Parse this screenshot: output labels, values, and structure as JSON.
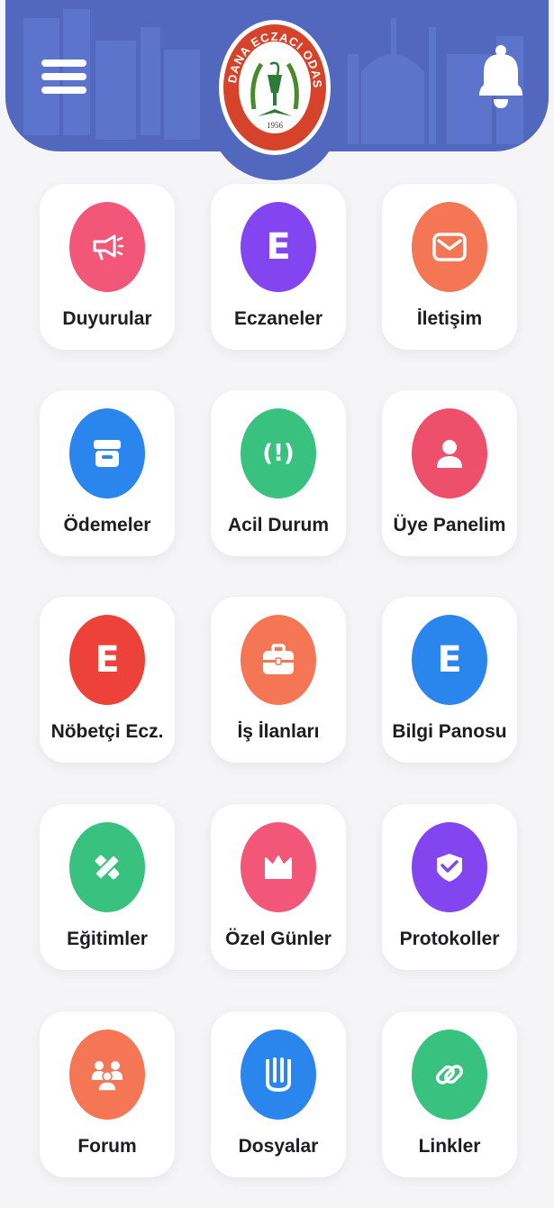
{
  "header": {
    "logo_text": "ADANA ECZACI ODASI",
    "logo_year": "1956",
    "menu_icon": "hamburger-menu-icon",
    "bell_icon": "bell-icon",
    "color": "#5268bf"
  },
  "tiles": [
    {
      "label": "Duyurular",
      "icon": "megaphone-icon",
      "color": "#f2577a"
    },
    {
      "label": "Eczaneler",
      "icon": "letter-e-icon",
      "glyph": "E",
      "color": "#8245ef"
    },
    {
      "label": "İletişim",
      "icon": "envelope-icon",
      "color": "#f47654"
    },
    {
      "label": "Ödemeler",
      "icon": "archive-box-icon",
      "color": "#2a86ec"
    },
    {
      "label": "Acil Durum",
      "icon": "alert-icon",
      "glyph": "(!)",
      "color": "#38c17f"
    },
    {
      "label": "Üye Panelim",
      "icon": "user-icon",
      "color": "#ee4f6b"
    },
    {
      "label": "Nöbetçi Ecz.",
      "icon": "letter-e-icon",
      "glyph": "E",
      "color": "#ec4239"
    },
    {
      "label": "İş İlanları",
      "icon": "briefcase-icon",
      "color": "#f47654"
    },
    {
      "label": "Bilgi Panosu",
      "icon": "letter-e-icon",
      "glyph": "E",
      "color": "#2a86ec"
    },
    {
      "label": "Eğitimler",
      "icon": "pencil-ruler-icon",
      "color": "#38c17f"
    },
    {
      "label": "Özel Günler",
      "icon": "crown-icon",
      "color": "#f2577a"
    },
    {
      "label": "Protokoller",
      "icon": "handshake-icon",
      "color": "#8245ef"
    },
    {
      "label": "Forum",
      "icon": "group-icon",
      "color": "#f47654"
    },
    {
      "label": "Dosyalar",
      "icon": "book-icon",
      "color": "#2a86ec"
    },
    {
      "label": "Linkler",
      "icon": "link-icon",
      "color": "#38c17f"
    }
  ]
}
